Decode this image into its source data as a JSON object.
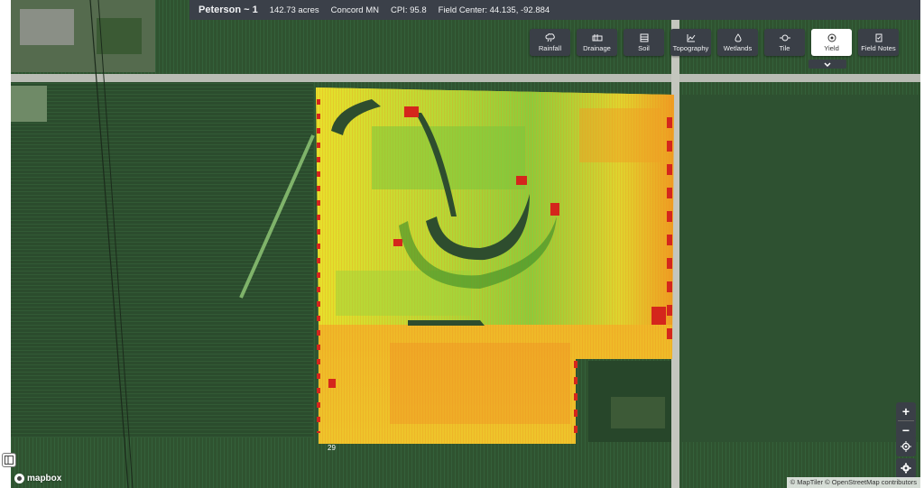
{
  "field": {
    "name": "Peterson ~ 1",
    "acres": "142.73 acres",
    "location": "Concord MN",
    "cpi": "CPI: 95.8",
    "center": "Field Center:  44.135, -92.884"
  },
  "layers": [
    {
      "label": "Rainfall",
      "icon": "cloud-rain-icon",
      "active": false
    },
    {
      "label": "Drainage",
      "icon": "drainage-icon",
      "active": false
    },
    {
      "label": "Soil",
      "icon": "soil-icon",
      "active": false
    },
    {
      "label": "Topography",
      "icon": "topography-icon",
      "active": false
    },
    {
      "label": "Wetlands",
      "icon": "wetlands-icon",
      "active": false
    },
    {
      "label": "Tile",
      "icon": "tile-icon",
      "active": false
    },
    {
      "label": "Yield",
      "icon": "yield-icon",
      "active": true
    },
    {
      "label": "Field Notes",
      "icon": "field-notes-icon",
      "active": false
    }
  ],
  "map": {
    "field_label": "29",
    "attribution": "© MapTiler © OpenStreetMap contributors",
    "logo": "mapbox",
    "yield_colors": {
      "high": "#3fae2a",
      "mid": "#e8e12b",
      "low": "#f09a1a",
      "poor": "#d4261c"
    }
  },
  "controls": {
    "zoom_in": "+",
    "zoom_out": "−"
  }
}
